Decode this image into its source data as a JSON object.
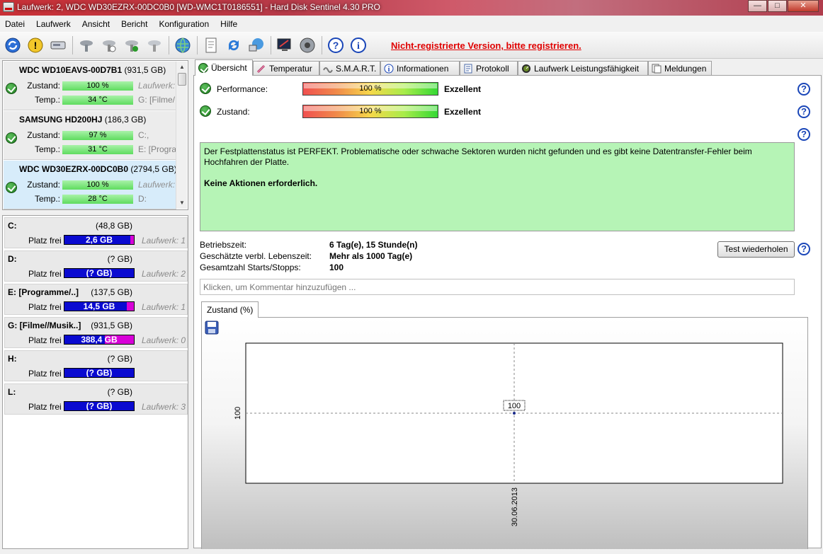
{
  "window": {
    "title": "Laufwerk: 2, WDC WD30EZRX-00DC0B0 [WD-WMC1T0186551]  -  Hard Disk Sentinel 4.30 PRO"
  },
  "menu": [
    "Datei",
    "Laufwerk",
    "Ansicht",
    "Bericht",
    "Konfiguration",
    "Hilfe"
  ],
  "toolbar": {
    "register_link": "Nicht-registrierte Version, bitte registrieren."
  },
  "disks": [
    {
      "name": "WDC WD10EAVS-00D7B1",
      "size": "(931,5 GB)",
      "zustand_label": "Zustand:",
      "zustand": "100 %",
      "temp_label": "Temp.:",
      "temp": "34 °C",
      "extra1": "Laufwerk:",
      "extra2": "G: [Filme/"
    },
    {
      "name": "SAMSUNG HD200HJ",
      "size": "(186,3 GB)",
      "zustand_label": "Zustand:",
      "zustand": "97 %",
      "temp_label": "Temp.:",
      "temp": "31 °C",
      "extra1": "C:,",
      "extra2": "E: [Progra"
    },
    {
      "name": "WDC WD30EZRX-00DC0B0",
      "size": "(2794,5 GB)",
      "zustand_label": "Zustand:",
      "zustand": "100 %",
      "temp_label": "Temp.:",
      "temp": "28 °C",
      "extra1": "Laufwerk:",
      "extra2": "D:"
    }
  ],
  "volumes": [
    {
      "name": "C:",
      "size": "(48,8 GB)",
      "free_label": "Platz frei",
      "free": "2,6 GB",
      "used_fraction": 0.05,
      "disk": "Laufwerk: 1"
    },
    {
      "name": "D:",
      "size": "(? GB)",
      "free_label": "Platz frei",
      "free": "(? GB)",
      "used_fraction": 0,
      "disk": "Laufwerk: 2"
    },
    {
      "name": "E: [Programme/..]",
      "size": "(137,5 GB)",
      "free_label": "Platz frei",
      "free": "14,5 GB",
      "used_fraction": 0.1,
      "disk": "Laufwerk: 1"
    },
    {
      "name": "G: [Filme//Musik..]",
      "size": "(931,5 GB)",
      "free_label": "Platz frei",
      "free": "388,4 GB",
      "used_fraction": 0.42,
      "disk": "Laufwerk: 0"
    },
    {
      "name": "H:",
      "size": "(? GB)",
      "free_label": "Platz frei",
      "free": "(? GB)",
      "used_fraction": 0,
      "disk": ""
    },
    {
      "name": "L:",
      "size": "(? GB)",
      "free_label": "Platz frei",
      "free": "(? GB)",
      "used_fraction": 0,
      "disk": "Laufwerk: 3"
    }
  ],
  "tabs": [
    "Übersicht",
    "Temperatur",
    "S.M.A.R.T.",
    "Informationen",
    "Protokoll",
    "Laufwerk Leistungsfähigkeit",
    "Meldungen"
  ],
  "overview": {
    "performance_label": "Performance:",
    "performance_value": "100 %",
    "performance_text": "Exzellent",
    "zustand_label": "Zustand:",
    "zustand_value": "100 %",
    "zustand_text": "Exzellent",
    "status_message": "Der Festplattenstatus ist PERFEKT. Problematische oder schwache Sektoren wurden nicht gefunden und es gibt keine Datentransfer-Fehler beim Hochfahren der Platte.",
    "status_action": "Keine Aktionen erforderlich.",
    "info": [
      {
        "label": "Betriebszeit:",
        "value": "6 Tag(e), 15 Stunde(n)"
      },
      {
        "label": "Geschätzte verbl. Lebenszeit:",
        "value": "Mehr als 1000 Tag(e)"
      },
      {
        "label": "Gesamtzahl Starts/Stopps:",
        "value": "100"
      }
    ],
    "test_button": "Test wiederholen",
    "comment_placeholder": "Klicken, um Kommentar hinzuzufügen ...",
    "chart_tab": "Zustand (%)"
  },
  "chart_data": {
    "type": "line",
    "x": [
      "30.06.2013"
    ],
    "series": [
      {
        "values": [
          100
        ]
      }
    ],
    "ylabel_tick": "100",
    "point_label": "100"
  },
  "colors": {
    "accent": "#1a46b8",
    "register": "#e00000",
    "status_bg": "#b6f4b6"
  }
}
